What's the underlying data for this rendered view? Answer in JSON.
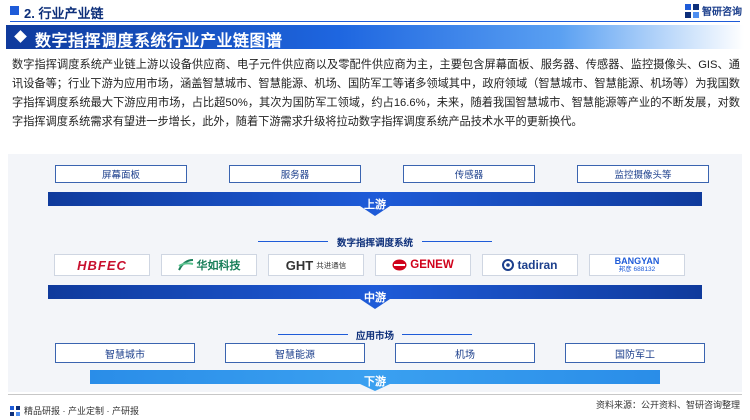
{
  "header": {
    "section_title": "2. 行业产业链",
    "brand": "智研咨询"
  },
  "banner": {
    "title": "数字指挥调度系统行业产业链图谱"
  },
  "paragraph": "数字指挥调度系统产业链上游以设备供应商、电子元件供应商以及零配件供应商为主，主要包含屏幕面板、服务器、传感器、监控摄像头、GIS、通讯设备等；行业下游为应用市场，涵盖智慧城市、智慧能源、机场、国防军工等诸多领域其中，政府领域（智慧城市、智慧能源、机场等）为我国数字指挥调度系统最大下游应用市场，占比超50%，其次为国防军工领域，约占16.6%，未来，随着我国智慧城市、智慧能源等产业的不断发展，对数字指挥调度系统需求有望进一步增长，此外，随着下游需求升级将拉动数字指挥调度系统产品技术水平的更新换代。",
  "upstream": {
    "items": [
      "屏幕面板",
      "服务器",
      "传感器",
      "监控摄像头等"
    ],
    "band_label": "上游"
  },
  "midstream": {
    "title": "数字指挥调度系统",
    "companies": [
      {
        "name": "HBFEC",
        "color": "#c8102e"
      },
      {
        "name": "华如科技",
        "color": "#1a7f5a"
      },
      {
        "name": "GHT",
        "sub": "共进通信",
        "color": "#333333"
      },
      {
        "name": "GENEW",
        "color": "#d0021b"
      },
      {
        "name": "tadiran",
        "color": "#1c3f8c"
      },
      {
        "name": "BANGYAN",
        "sub": "邦彦 688132",
        "color": "#1e5bd8"
      }
    ],
    "band_label": "中游"
  },
  "downstream": {
    "title": "应用市场",
    "items": [
      "智慧城市",
      "智慧能源",
      "机场",
      "国防军工"
    ],
    "band_label": "下游"
  },
  "footer": {
    "left": "精品研报 · 产业定制 · 产研报",
    "source": "资料来源：公开资料、智研咨询整理"
  },
  "colors": {
    "primary": "#1e5bd8",
    "dark": "#0d2f7a"
  }
}
